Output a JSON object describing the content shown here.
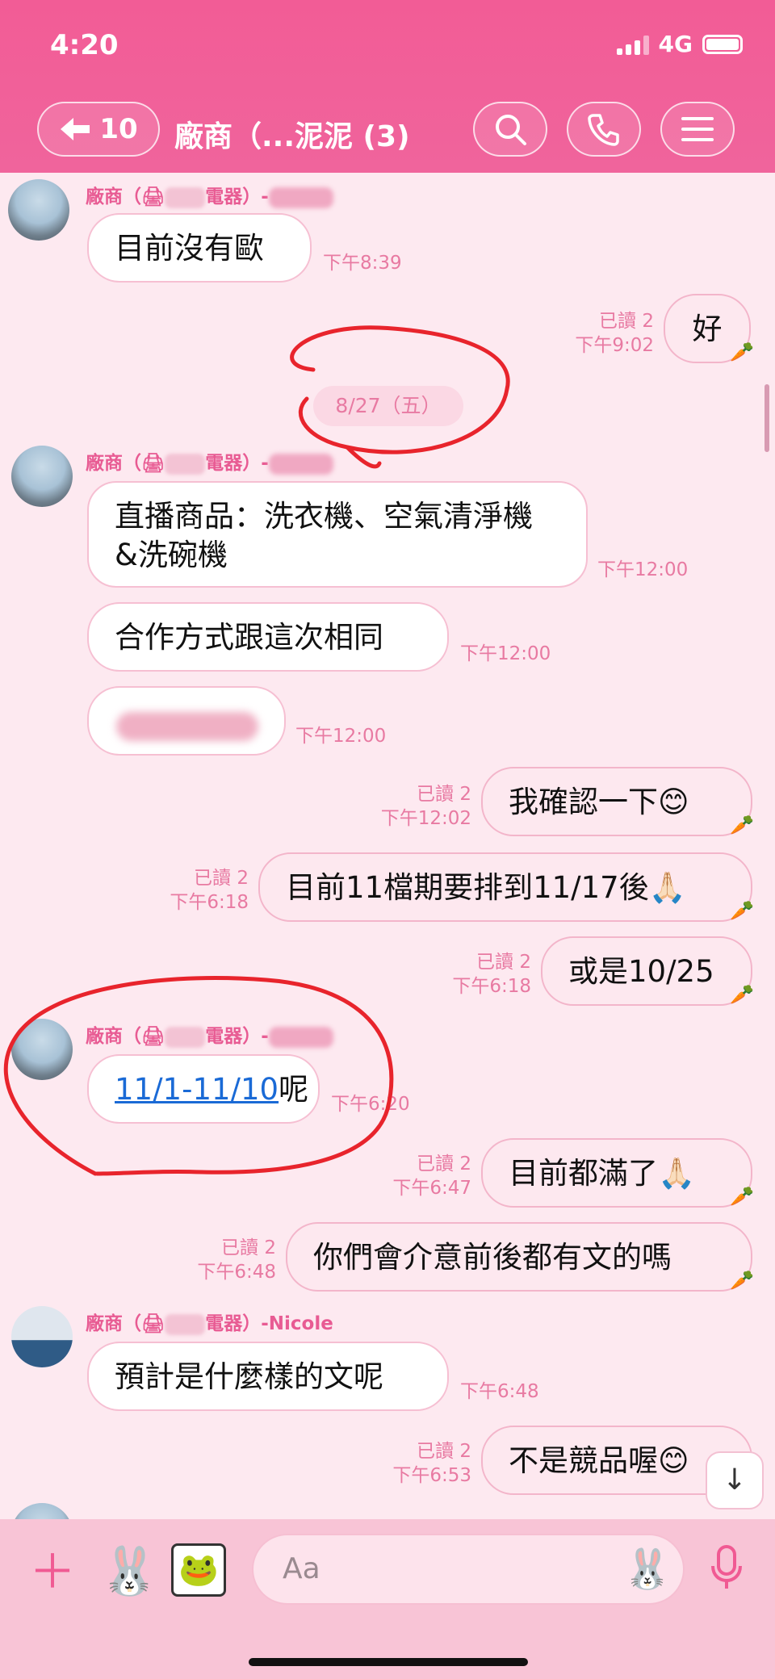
{
  "status": {
    "time": "4:20",
    "network": "4G"
  },
  "header": {
    "back_count": "10",
    "title": "廠商（...泥泥 (3)",
    "icons": [
      "back-arrow-icon",
      "search-icon",
      "phone-icon",
      "menu-icon"
    ]
  },
  "date_divider": "8/27（五）",
  "sender_prefix": "廠商（",
  "sender_suffix": "電器）-",
  "sender_full_suffix": "電器）-Nicole",
  "messages": {
    "m1": {
      "text": "目前沒有歐",
      "time": "下午8:39"
    },
    "m2": {
      "text": "好",
      "read": "已讀 2",
      "time": "下午9:02"
    },
    "m3": {
      "text": "直播商品：洗衣機、空氣清淨機 &洗碗機",
      "time": "下午12:00"
    },
    "m4": {
      "text": "合作方式跟這次相同",
      "time": "下午12:00"
    },
    "m5": {
      "time": "下午12:00"
    },
    "m6": {
      "text": "我確認一下😊",
      "read": "已讀 2",
      "time": "下午12:02"
    },
    "m7": {
      "text": "目前11檔期要排到11/17後🙏🏻",
      "read": "已讀 2",
      "time": "下午6:18"
    },
    "m8": {
      "text": "或是10/25",
      "read": "已讀 2",
      "time": "下午6:18"
    },
    "m9": {
      "link": "11/1-11/10",
      "text": "呢",
      "time": "下午6:20"
    },
    "m10": {
      "text": "目前都滿了🙏🏻",
      "read": "已讀 2",
      "time": "下午6:47"
    },
    "m11": {
      "text": "你們會介意前後都有文的嗎",
      "read": "已讀 2",
      "time": "下午6:48"
    },
    "m12": {
      "text": "預計是什麼樣的文呢",
      "time": "下午6:48"
    },
    "m13": {
      "text": "不是競品喔😊",
      "read": "已讀 2",
      "time": "下午6:53"
    }
  },
  "input": {
    "placeholder": "Aa"
  },
  "colors": {
    "header": "#f25c96",
    "accent": "#e85b93",
    "annotation": "#e8242c"
  }
}
